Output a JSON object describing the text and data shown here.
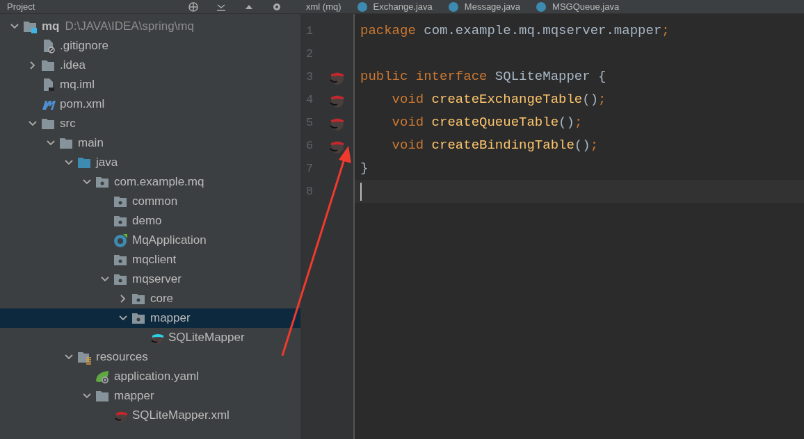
{
  "project_panel": {
    "title": "Project"
  },
  "tree": [
    {
      "label": "mq",
      "path": "D:\\JAVA\\IDEA\\spring\\mq",
      "kind": "module",
      "expanded": true,
      "selected": false,
      "children": [
        {
          "label": ".gitignore",
          "kind": "ignored",
          "selected": false
        },
        {
          "label": ".idea",
          "kind": "folder",
          "expanded": false,
          "selected": false
        },
        {
          "label": "mq.iml",
          "kind": "file",
          "selected": false
        },
        {
          "label": "pom.xml",
          "kind": "maven",
          "selected": false
        },
        {
          "label": "src",
          "kind": "folder",
          "expanded": true,
          "selected": false,
          "children": [
            {
              "label": "main",
              "kind": "folder",
              "expanded": true,
              "selected": false,
              "children": [
                {
                  "label": "java",
                  "kind": "sources",
                  "expanded": true,
                  "selected": false,
                  "children": [
                    {
                      "label": "com.example.mq",
                      "kind": "package",
                      "expanded": true,
                      "selected": false,
                      "children": [
                        {
                          "label": "common",
                          "kind": "package",
                          "selected": false
                        },
                        {
                          "label": "demo",
                          "kind": "package",
                          "selected": false
                        },
                        {
                          "label": "MqApplication",
                          "kind": "class",
                          "selected": false
                        },
                        {
                          "label": "mqclient",
                          "kind": "package",
                          "selected": false
                        },
                        {
                          "label": "mqserver",
                          "kind": "package",
                          "expanded": true,
                          "selected": false,
                          "children": [
                            {
                              "label": "core",
                              "kind": "package",
                              "expanded": false,
                              "selected": false
                            },
                            {
                              "label": "mapper",
                              "kind": "package",
                              "expanded": true,
                              "selected": true,
                              "children": [
                                {
                                  "label": "SQLiteMapper",
                                  "kind": "mapper",
                                  "selected": false
                                }
                              ]
                            }
                          ]
                        }
                      ]
                    }
                  ]
                },
                {
                  "label": "resources",
                  "kind": "resources",
                  "expanded": true,
                  "selected": false,
                  "children": [
                    {
                      "label": "application.yaml",
                      "kind": "spring",
                      "selected": false
                    },
                    {
                      "label": "mapper",
                      "kind": "folder",
                      "expanded": true,
                      "selected": false,
                      "children": [
                        {
                          "label": "SQLiteMapper.xml",
                          "kind": "xml",
                          "selected": false
                        }
                      ]
                    }
                  ]
                }
              ]
            }
          ]
        }
      ]
    }
  ],
  "editor_tabs": [
    {
      "label": "xml (mq)",
      "kind": "xml"
    },
    {
      "label": "Exchange.java",
      "kind": "class"
    },
    {
      "label": "Message.java",
      "kind": "class"
    },
    {
      "label": "MSGQueue.java",
      "kind": "class"
    }
  ],
  "code_lines": [
    {
      "number": "1",
      "marker": false,
      "current": false,
      "tokens": [
        {
          "kind": "keyword",
          "text": "package"
        },
        {
          "kind": "plain",
          "text": " com.example.mq.mqserver.mapper"
        },
        {
          "kind": "keyword",
          "text": ";"
        }
      ]
    },
    {
      "number": "2",
      "marker": false,
      "current": false
    },
    {
      "number": "3",
      "marker": true,
      "current": false,
      "tokens": [
        {
          "kind": "keyword",
          "text": "public interface"
        },
        {
          "kind": "plain",
          "text": " SQLiteMapper {"
        }
      ]
    },
    {
      "number": "4",
      "marker": true,
      "current": false,
      "tokens": [
        {
          "kind": "keyword",
          "text": "    void"
        },
        {
          "kind": "method",
          "text": " createExchangeTable"
        },
        {
          "kind": "plain",
          "text": "()"
        },
        {
          "kind": "keyword",
          "text": ";"
        }
      ]
    },
    {
      "number": "5",
      "marker": true,
      "current": false,
      "tokens": [
        {
          "kind": "keyword",
          "text": "    void"
        },
        {
          "kind": "method",
          "text": " createQueueTable"
        },
        {
          "kind": "plain",
          "text": "()"
        },
        {
          "kind": "keyword",
          "text": ";"
        }
      ]
    },
    {
      "number": "6",
      "marker": true,
      "current": false,
      "tokens": [
        {
          "kind": "keyword",
          "text": "    void"
        },
        {
          "kind": "method",
          "text": " createBindingTable"
        },
        {
          "kind": "plain",
          "text": "()"
        },
        {
          "kind": "keyword",
          "text": ";"
        }
      ]
    },
    {
      "number": "7",
      "marker": false,
      "current": false,
      "tokens": [
        {
          "kind": "plain",
          "text": "}"
        }
      ]
    },
    {
      "number": "8",
      "marker": false,
      "current": true
    }
  ]
}
